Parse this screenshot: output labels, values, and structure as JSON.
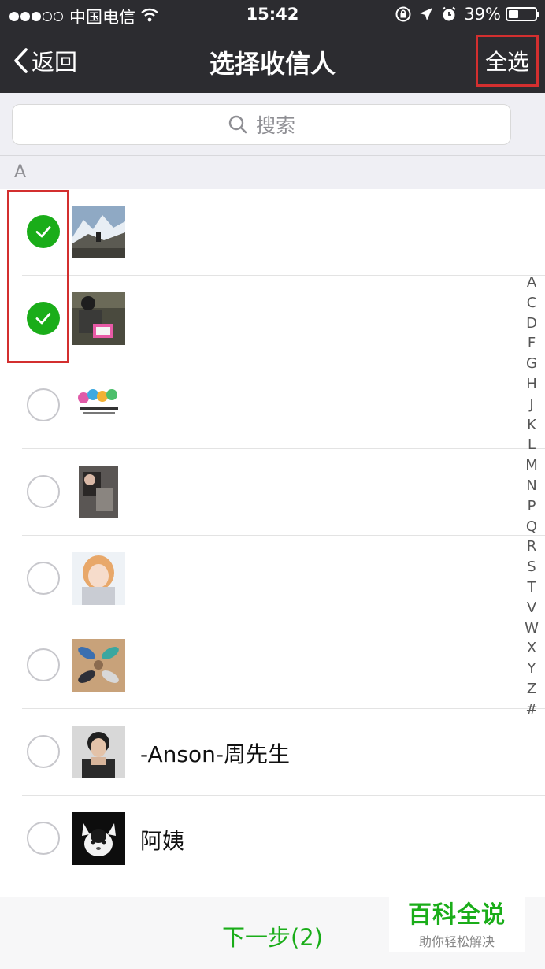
{
  "status_bar": {
    "carrier": "中国电信",
    "time": "15:42",
    "battery": "39%",
    "battery_level": 0.39,
    "signal_bars_filled": 3,
    "signal_bars_total": 5
  },
  "nav": {
    "back_label": "返回",
    "title": "选择收信人",
    "select_all_label": "全选"
  },
  "search": {
    "placeholder": "搜索"
  },
  "section": {
    "letter": "A"
  },
  "contacts": [
    {
      "name": "",
      "checked": true
    },
    {
      "name": "",
      "checked": true
    },
    {
      "name": "",
      "checked": false
    },
    {
      "name": "",
      "checked": false
    },
    {
      "name": "",
      "checked": false
    },
    {
      "name": "",
      "checked": false
    },
    {
      "name": "-Anson-周先生",
      "checked": false
    },
    {
      "name": "阿姨",
      "checked": false
    }
  ],
  "index_letters": [
    "A",
    "C",
    "D",
    "F",
    "G",
    "H",
    "J",
    "K",
    "L",
    "M",
    "N",
    "P",
    "Q",
    "R",
    "S",
    "T",
    "V",
    "W",
    "X",
    "Y",
    "Z",
    "#"
  ],
  "bottom": {
    "next_label": "下一步(2)"
  },
  "watermark": {
    "title": "百科全说",
    "subtitle": "助你轻松解决"
  },
  "colors": {
    "accent_green": "#1aad19",
    "nav_background": "#2c2c30",
    "highlight_red": "#d32f2f"
  }
}
